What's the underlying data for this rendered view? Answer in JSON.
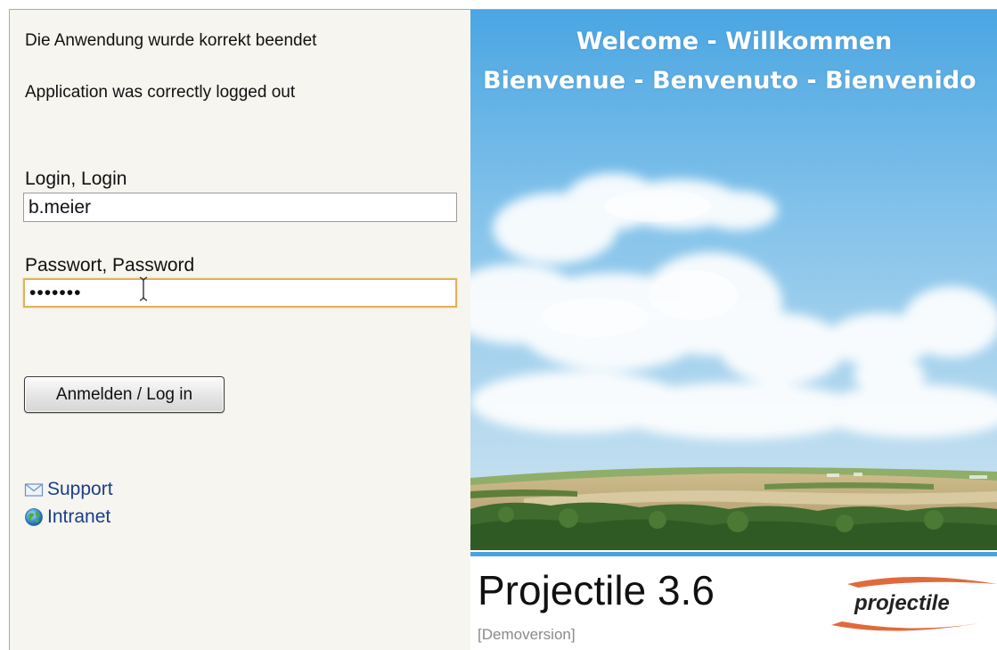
{
  "messages": {
    "logout_de": "Die Anwendung wurde korrekt beendet",
    "logout_en": "Application was correctly logged out"
  },
  "form": {
    "login_label": "Login, Login",
    "login_value": "b.meier",
    "password_label": "Passwort, Password",
    "password_value": "•••••••",
    "submit_label": "Anmelden / Log in"
  },
  "links": {
    "support": {
      "label": "Support",
      "icon": "envelope-icon"
    },
    "intranet": {
      "label": "Intranet",
      "icon": "globe-icon"
    }
  },
  "welcome": {
    "line1": "Welcome - Willkommen",
    "line2": "Bienvenue - Benvenuto - Bienvenido"
  },
  "product": {
    "title": "Projectile 3.6",
    "edition": "[Demoversion]",
    "logo_text": "projectile"
  },
  "colors": {
    "panel_background": "#f6f5ef",
    "link": "#1a3e8c",
    "focus_border": "#e0b060",
    "accent_rule": "#4aa3df",
    "logo_swoosh": "#e06a3c"
  }
}
